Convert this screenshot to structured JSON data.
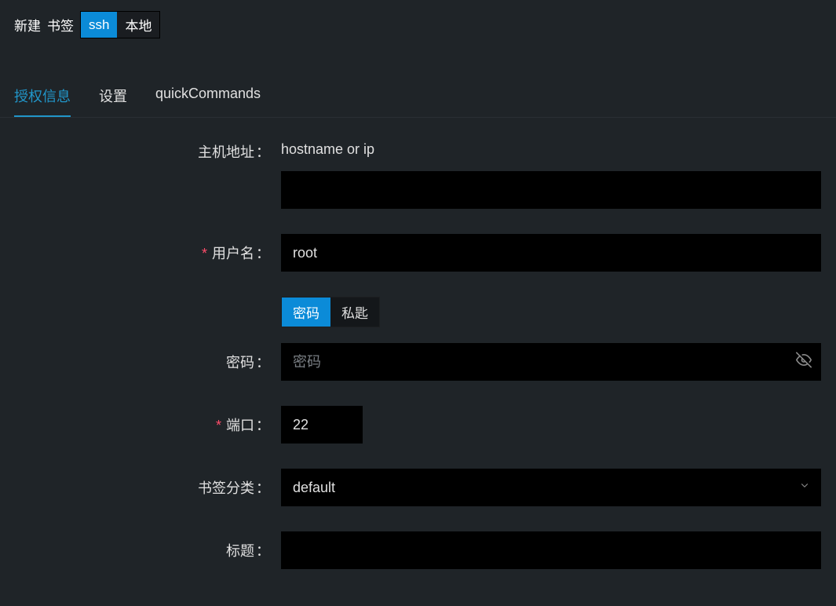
{
  "header": {
    "new_label": "新建",
    "bookmark_label": "书签",
    "conn_toggle": {
      "ssh": "ssh",
      "local": "本地"
    }
  },
  "tabs": {
    "auth": "授权信息",
    "settings": "设置",
    "quick": "quickCommands"
  },
  "form": {
    "host": {
      "label": "主机地址",
      "hint": "hostname or ip",
      "value": ""
    },
    "username": {
      "label": "用户名",
      "value": "root"
    },
    "auth_mode": {
      "password": "密码",
      "private_key": "私匙"
    },
    "password": {
      "label": "密码",
      "placeholder": "密码",
      "value": ""
    },
    "port": {
      "label": "端口",
      "value": "22"
    },
    "category": {
      "label": "书签分类",
      "value": "default"
    },
    "title": {
      "label": "标题",
      "value": ""
    }
  }
}
